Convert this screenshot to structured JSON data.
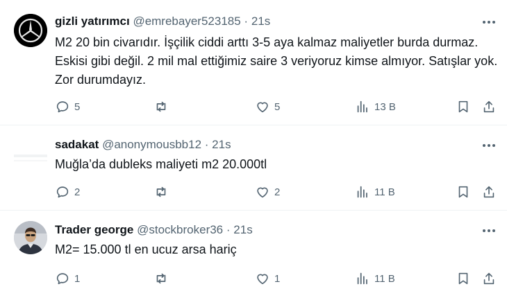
{
  "tweets": [
    {
      "name": "gizli yatırımcı",
      "handle": "@emrebayer523185",
      "separator": "·",
      "time": "21s",
      "text": "M2 20 bin civarıdır. İşçilik ciddi arttı 3-5 aya kalmaz maliyetler burda durmaz. Eskisi gibi değil. 2 mil mal ettiğimiz saire 3 veriyoruz kimse almıyor. Satışlar yok. Zor durumdayız.",
      "replies": "5",
      "reposts": "",
      "likes": "5",
      "views": "13 B",
      "avatar": "mercedes-logo-icon"
    },
    {
      "name": "sadakat",
      "handle": "@anonymousbb12",
      "separator": "·",
      "time": "21s",
      "text": "Muğla’da dubleks maliyeti m2 20.000tl",
      "replies": "2",
      "reposts": "",
      "likes": "2",
      "views": "11 B",
      "avatar": "blank-avatar"
    },
    {
      "name": "Trader george",
      "handle": "@stockbroker36",
      "separator": "·",
      "time": "21s",
      "text": "M2= 15.000 tl en ucuz arsa hariç",
      "replies": "1",
      "reposts": "",
      "likes": "1",
      "views": "11 B",
      "avatar": "person-photo-avatar"
    }
  ],
  "colors": {
    "text": "#0f1419",
    "secondary": "#536471",
    "divider": "#eff3f4"
  }
}
